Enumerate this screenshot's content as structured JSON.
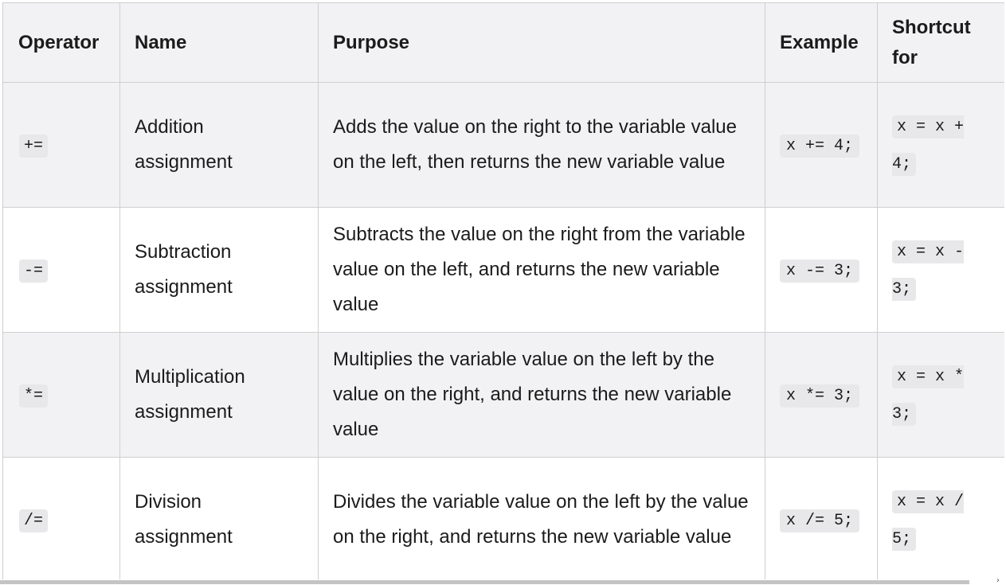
{
  "table": {
    "headers": {
      "operator": "Operator",
      "name": "Name",
      "purpose": "Purpose",
      "example": "Example",
      "shortcut": "Shortcut for"
    },
    "rows": [
      {
        "operator": "+=",
        "name": "Addition assignment",
        "purpose": "Adds the value on the right to the variable value on the left, then returns the new variable value",
        "example": "x += 4;",
        "shortcut": "x = x + 4;"
      },
      {
        "operator": "-=",
        "name": "Subtraction assignment",
        "purpose": "Subtracts the value on the right from the variable value on the left, and returns the new variable value",
        "example": "x -= 3;",
        "shortcut": "x = x - 3;"
      },
      {
        "operator": "*=",
        "name": "Multiplication assignment",
        "purpose": "Multiplies the variable value on the left by the value on the right, and returns the new variable value",
        "example": "x *= 3;",
        "shortcut": "x = x * 3;"
      },
      {
        "operator": "/=",
        "name": "Division assignment",
        "purpose": "Divides the variable value on the left by the value on the right, and returns the new variable value",
        "example": "x /= 5;",
        "shortcut": "x = x / 5;"
      }
    ]
  },
  "scrollbar": {
    "arrow_icon": "chevron-right-icon"
  }
}
